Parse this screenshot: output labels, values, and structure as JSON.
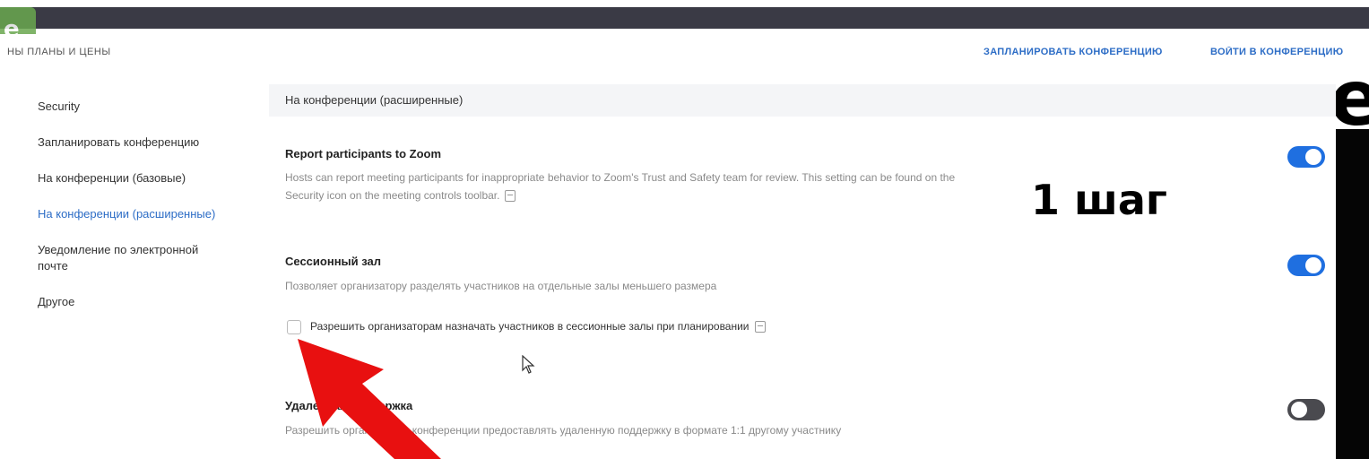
{
  "topnav": {
    "plans": "НЫ ПЛАНЫ И ЦЕНЫ",
    "schedule": "ЗАПЛАНИРОВАТЬ КОНФЕРЕНЦИЮ",
    "join": "ВОЙТИ В КОНФЕРЕНЦИЮ"
  },
  "sidebar": {
    "items": [
      {
        "label": "Security"
      },
      {
        "label": "Запланировать конференцию"
      },
      {
        "label": "На конференции (базовые)"
      },
      {
        "label": "На конференции (расширенные)"
      },
      {
        "label": "Уведомление по электронной почте"
      },
      {
        "label": "Другое"
      }
    ]
  },
  "main": {
    "section_title": "На конференции (расширенные)",
    "settings": [
      {
        "title": "Report participants to Zoom",
        "description": "Hosts can report meeting participants for inappropriate behavior to Zoom's Trust and Safety team for review. This setting can be found on the Security icon on the meeting controls toolbar.",
        "enabled": true
      },
      {
        "title": "Сессионный зал",
        "description": "Позволяет организатору разделять участников на отдельные залы меньшего размера",
        "checkbox_label": "Разрешить организаторам назначать участников в сессионные залы при планировании",
        "checkbox_checked": false,
        "enabled": true
      },
      {
        "title": "Удаленная поддержка",
        "description": "Разрешить организатору конференции предоставлять удаленную поддержку в формате 1:1 другому участнику",
        "enabled": false
      }
    ]
  },
  "overlay": {
    "step_text": "1 шаг",
    "arrow_color": "#e81010"
  },
  "colors": {
    "accent": "#2d6dc6",
    "toggle_on": "#1f6fe0",
    "toggle_off": "#4a4a4f"
  }
}
